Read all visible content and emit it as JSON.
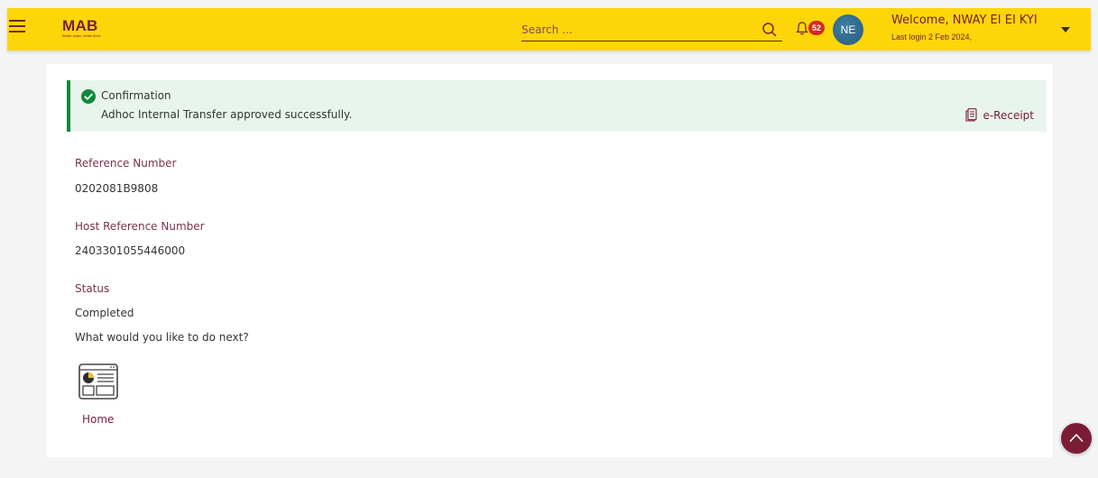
{
  "header": {
    "logo_title": "MAB",
    "logo_tagline": "Better ways, better lives",
    "search_placeholder": "Search ...",
    "notification_count": "52",
    "avatar_initials": "NE",
    "welcome_text": "Welcome, NWAY EI EI KYI",
    "last_login": "Last login 2 Feb 2024,"
  },
  "confirmation": {
    "title": "Confirmation",
    "message": "Adhoc Internal Transfer approved successfully.",
    "receipt_label": "e-Receipt"
  },
  "details": [
    {
      "label": "Reference Number",
      "value": "0202081B9808"
    },
    {
      "label": "Host Reference Number",
      "value": "2403301055446000"
    },
    {
      "label": "Status",
      "value": "Completed"
    }
  ],
  "next": {
    "question": "What would you like to do next?",
    "home_label": "Home"
  },
  "colors": {
    "brand_yellow": "#fdd60a",
    "brand_maroon": "#7a1c36",
    "success_green": "#0f8a3a",
    "confirm_bg": "#e9f5ec"
  },
  "icons": [
    "menu-icon",
    "search-icon",
    "bell-icon",
    "check-circle-icon",
    "receipt-icon",
    "dashboard-icon",
    "chevron-up-icon",
    "caret-down-icon"
  ]
}
